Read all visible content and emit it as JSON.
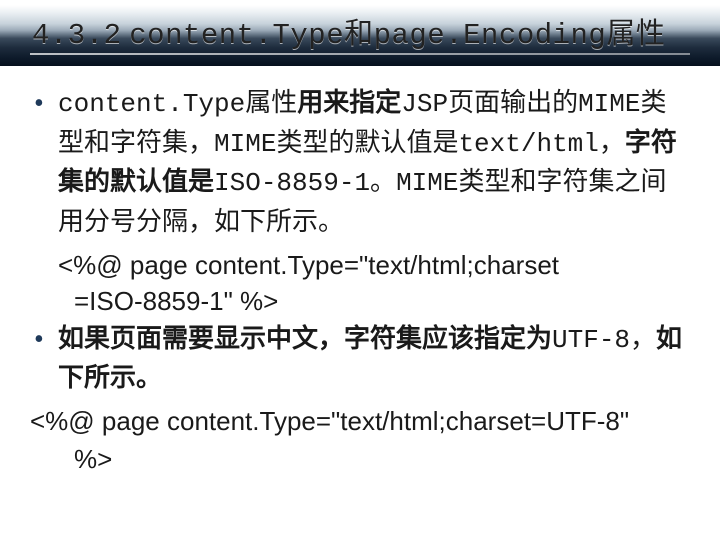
{
  "title": {
    "section_num": "4.3.2",
    "label": "content.Type和page.Encoding属性"
  },
  "body": {
    "bullet1": {
      "lead": "content.Type属性",
      "text1": "用来指定",
      "mono1": "JSP",
      "text2": "页面输出的",
      "mono2": "MIME",
      "text3": "类型和字符集，",
      "mono3": "MIME",
      "text4": "类型的默认值是",
      "mono4": "text/html，",
      "text5": "字符集的默认值是",
      "mono5": "ISO-8859-1",
      "text6": "。",
      "mono6": "MIME",
      "text7": "类型和字符集之间用分号分隔，如下所示。"
    },
    "code1a": "<%@ page content.Type=\"text/html;charset",
    "code1b": "=ISO-8859-1\" %>",
    "bullet2": {
      "text1": "如果页面需要显示中文，字符集应该指定为",
      "mono1": "UTF-8，",
      "text2": "如下所示。"
    },
    "code2a": "<%@ page content.Type=\"text/html;charset=UTF-8\"",
    "code2b": "%>"
  }
}
